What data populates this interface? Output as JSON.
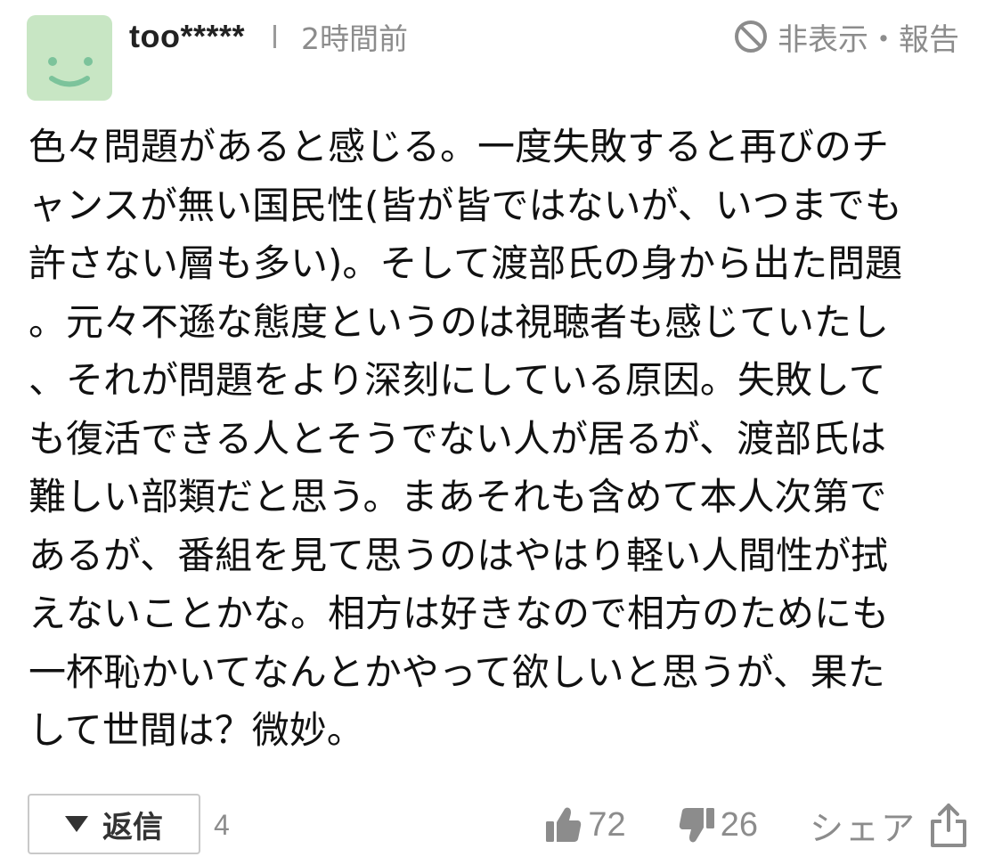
{
  "comment": {
    "user": {
      "name": "too*****",
      "avatar_icon": "smiley-face-icon",
      "avatar_color": "#c8e6c4"
    },
    "time": "2時間前",
    "hide_report_label": "非表示・報告",
    "body_lines": [
      "色々問題があると感じる。一度失敗すると再びのチ",
      "ャンスが無い国民性(皆が皆ではないが、いつまでも",
      "許さない層も多い)。そして渡部氏の身から出た問題",
      "。元々不遜な態度というのは視聴者も感じていたし",
      "、それが問題をより深刻にしている原因。失敗して",
      "も復活できる人とそうでない人が居るが、渡部氏は",
      "難しい部類だと思う。まあそれも含めて本人次第で",
      "あるが、番組を見て思うのはやはり軽い人間性が拭",
      "えないことかな。相方は好きなので相方のためにも",
      "一杯恥かいてなんとかやって欲しいと思うが、果た",
      "して世間は？微妙。"
    ],
    "reply_label": "返信",
    "reply_count": "4",
    "likes": "72",
    "dislikes": "26",
    "share_label": "シェア"
  }
}
